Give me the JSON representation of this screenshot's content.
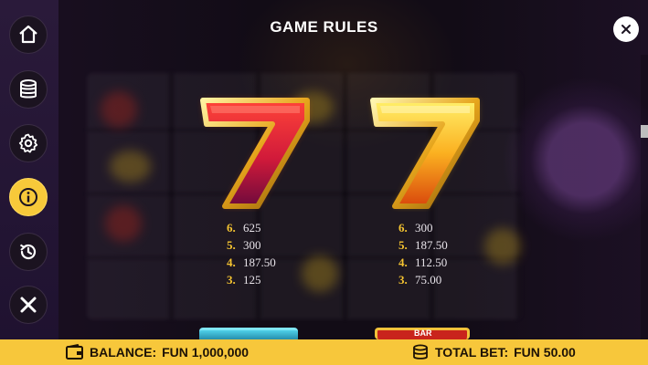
{
  "title": "GAME RULES",
  "sidebar": {
    "buttons": [
      {
        "icon": "home-icon",
        "active": false
      },
      {
        "icon": "coin-stack-icon",
        "active": false
      },
      {
        "icon": "gear-icon",
        "active": false
      },
      {
        "icon": "info-icon",
        "active": true
      },
      {
        "icon": "history-icon",
        "active": false
      },
      {
        "icon": "close-icon",
        "active": false
      }
    ]
  },
  "symbols": [
    {
      "name": "red-seven",
      "glyph": "7",
      "colors": {
        "top": "#ff3a3a",
        "bottom": "#7a0a3a",
        "edge": "#f7c43a"
      },
      "payouts": [
        {
          "count": "6.",
          "value": "625"
        },
        {
          "count": "5.",
          "value": "300"
        },
        {
          "count": "4.",
          "value": "187.50"
        },
        {
          "count": "3.",
          "value": "125"
        }
      ]
    },
    {
      "name": "gold-seven",
      "glyph": "7",
      "colors": {
        "top": "#ffe14a",
        "bottom": "#e0560f",
        "edge": "#f7c43a"
      },
      "payouts": [
        {
          "count": "6.",
          "value": "300"
        },
        {
          "count": "5.",
          "value": "187.50"
        },
        {
          "count": "4.",
          "value": "112.50"
        },
        {
          "count": "3.",
          "value": "75.00"
        }
      ]
    }
  ],
  "bottom_bar": {
    "balance_label": "BALANCE:",
    "balance_value": "FUN 1,000,000",
    "total_bet_label": "TOTAL BET:",
    "total_bet_value": "FUN 50.00"
  },
  "colors": {
    "accent": "#f7c73b",
    "sidebar": "#24163a",
    "payout_count": "#f5c431"
  }
}
